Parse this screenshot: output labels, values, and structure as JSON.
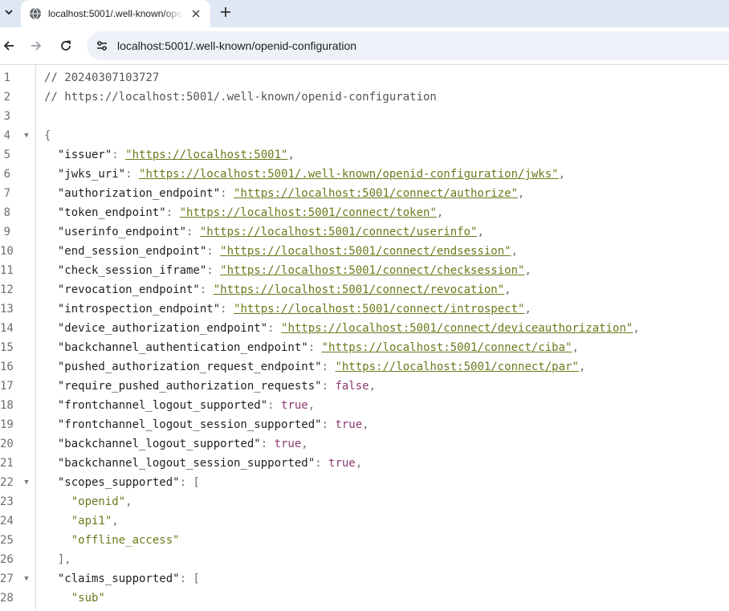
{
  "browser": {
    "tab": {
      "title": "localhost:5001/.well-known/openid-configuration",
      "globe_icon": "globe-icon",
      "close_icon": "close-icon"
    },
    "new_tab_icon": "plus-icon",
    "toolbar": {
      "back_icon": "arrow-left-icon",
      "forward_icon": "arrow-right-icon",
      "reload_icon": "reload-icon",
      "site_info_icon": "tune-icon",
      "url": "localhost:5001/.well-known/openid-configuration"
    }
  },
  "code": {
    "lines": [
      {
        "n": "1",
        "fold": "",
        "parts": [
          {
            "t": "// 20240307103727",
            "c": "comment"
          }
        ]
      },
      {
        "n": "2",
        "fold": "",
        "parts": [
          {
            "t": "// https://localhost:5001/.well-known/openid-configuration",
            "c": "comment"
          }
        ]
      },
      {
        "n": "3",
        "fold": "",
        "parts": []
      },
      {
        "n": "4",
        "fold": "▼",
        "parts": [
          {
            "t": "{",
            "c": "punct"
          }
        ]
      },
      {
        "n": "5",
        "fold": "",
        "parts": [
          {
            "t": "  \"issuer\"",
            "c": "key"
          },
          {
            "t": ": ",
            "c": "punct"
          },
          {
            "t": "\"https://localhost:5001\"",
            "c": "link"
          },
          {
            "t": ",",
            "c": "punct"
          }
        ]
      },
      {
        "n": "6",
        "fold": "",
        "parts": [
          {
            "t": "  \"jwks_uri\"",
            "c": "key"
          },
          {
            "t": ": ",
            "c": "punct"
          },
          {
            "t": "\"https://localhost:5001/.well-known/openid-configuration/jwks\"",
            "c": "link"
          },
          {
            "t": ",",
            "c": "punct"
          }
        ]
      },
      {
        "n": "7",
        "fold": "",
        "parts": [
          {
            "t": "  \"authorization_endpoint\"",
            "c": "key"
          },
          {
            "t": ": ",
            "c": "punct"
          },
          {
            "t": "\"https://localhost:5001/connect/authorize\"",
            "c": "link"
          },
          {
            "t": ",",
            "c": "punct"
          }
        ]
      },
      {
        "n": "8",
        "fold": "",
        "parts": [
          {
            "t": "  \"token_endpoint\"",
            "c": "key"
          },
          {
            "t": ": ",
            "c": "punct"
          },
          {
            "t": "\"https://localhost:5001/connect/token\"",
            "c": "link"
          },
          {
            "t": ",",
            "c": "punct"
          }
        ]
      },
      {
        "n": "9",
        "fold": "",
        "parts": [
          {
            "t": "  \"userinfo_endpoint\"",
            "c": "key"
          },
          {
            "t": ": ",
            "c": "punct"
          },
          {
            "t": "\"https://localhost:5001/connect/userinfo\"",
            "c": "link"
          },
          {
            "t": ",",
            "c": "punct"
          }
        ]
      },
      {
        "n": "10",
        "fold": "",
        "parts": [
          {
            "t": "  \"end_session_endpoint\"",
            "c": "key"
          },
          {
            "t": ": ",
            "c": "punct"
          },
          {
            "t": "\"https://localhost:5001/connect/endsession\"",
            "c": "link"
          },
          {
            "t": ",",
            "c": "punct"
          }
        ]
      },
      {
        "n": "11",
        "fold": "",
        "parts": [
          {
            "t": "  \"check_session_iframe\"",
            "c": "key"
          },
          {
            "t": ": ",
            "c": "punct"
          },
          {
            "t": "\"https://localhost:5001/connect/checksession\"",
            "c": "link"
          },
          {
            "t": ",",
            "c": "punct"
          }
        ]
      },
      {
        "n": "12",
        "fold": "",
        "parts": [
          {
            "t": "  \"revocation_endpoint\"",
            "c": "key"
          },
          {
            "t": ": ",
            "c": "punct"
          },
          {
            "t": "\"https://localhost:5001/connect/revocation\"",
            "c": "link"
          },
          {
            "t": ",",
            "c": "punct"
          }
        ]
      },
      {
        "n": "13",
        "fold": "",
        "parts": [
          {
            "t": "  \"introspection_endpoint\"",
            "c": "key"
          },
          {
            "t": ": ",
            "c": "punct"
          },
          {
            "t": "\"https://localhost:5001/connect/introspect\"",
            "c": "link"
          },
          {
            "t": ",",
            "c": "punct"
          }
        ]
      },
      {
        "n": "14",
        "fold": "",
        "parts": [
          {
            "t": "  \"device_authorization_endpoint\"",
            "c": "key"
          },
          {
            "t": ": ",
            "c": "punct"
          },
          {
            "t": "\"https://localhost:5001/connect/deviceauthorization\"",
            "c": "link"
          },
          {
            "t": ",",
            "c": "punct"
          }
        ]
      },
      {
        "n": "15",
        "fold": "",
        "parts": [
          {
            "t": "  \"backchannel_authentication_endpoint\"",
            "c": "key"
          },
          {
            "t": ": ",
            "c": "punct"
          },
          {
            "t": "\"https://localhost:5001/connect/ciba\"",
            "c": "link"
          },
          {
            "t": ",",
            "c": "punct"
          }
        ]
      },
      {
        "n": "16",
        "fold": "",
        "parts": [
          {
            "t": "  \"pushed_authorization_request_endpoint\"",
            "c": "key"
          },
          {
            "t": ": ",
            "c": "punct"
          },
          {
            "t": "\"https://localhost:5001/connect/par\"",
            "c": "link"
          },
          {
            "t": ",",
            "c": "punct"
          }
        ]
      },
      {
        "n": "17",
        "fold": "",
        "parts": [
          {
            "t": "  \"require_pushed_authorization_requests\"",
            "c": "key"
          },
          {
            "t": ": ",
            "c": "punct"
          },
          {
            "t": "false",
            "c": "bool"
          },
          {
            "t": ",",
            "c": "punct"
          }
        ]
      },
      {
        "n": "18",
        "fold": "",
        "parts": [
          {
            "t": "  \"frontchannel_logout_supported\"",
            "c": "key"
          },
          {
            "t": ": ",
            "c": "punct"
          },
          {
            "t": "true",
            "c": "bool"
          },
          {
            "t": ",",
            "c": "punct"
          }
        ]
      },
      {
        "n": "19",
        "fold": "",
        "parts": [
          {
            "t": "  \"frontchannel_logout_session_supported\"",
            "c": "key"
          },
          {
            "t": ": ",
            "c": "punct"
          },
          {
            "t": "true",
            "c": "bool"
          },
          {
            "t": ",",
            "c": "punct"
          }
        ]
      },
      {
        "n": "20",
        "fold": "",
        "parts": [
          {
            "t": "  \"backchannel_logout_supported\"",
            "c": "key"
          },
          {
            "t": ": ",
            "c": "punct"
          },
          {
            "t": "true",
            "c": "bool"
          },
          {
            "t": ",",
            "c": "punct"
          }
        ]
      },
      {
        "n": "21",
        "fold": "",
        "parts": [
          {
            "t": "  \"backchannel_logout_session_supported\"",
            "c": "key"
          },
          {
            "t": ": ",
            "c": "punct"
          },
          {
            "t": "true",
            "c": "bool"
          },
          {
            "t": ",",
            "c": "punct"
          }
        ]
      },
      {
        "n": "22",
        "fold": "▼",
        "parts": [
          {
            "t": "  \"scopes_supported\"",
            "c": "key"
          },
          {
            "t": ": [",
            "c": "punct"
          }
        ]
      },
      {
        "n": "23",
        "fold": "",
        "parts": [
          {
            "t": "    \"openid\"",
            "c": "str"
          },
          {
            "t": ",",
            "c": "punct"
          }
        ]
      },
      {
        "n": "24",
        "fold": "",
        "parts": [
          {
            "t": "    \"api1\"",
            "c": "str"
          },
          {
            "t": ",",
            "c": "punct"
          }
        ]
      },
      {
        "n": "25",
        "fold": "",
        "parts": [
          {
            "t": "    \"offline_access\"",
            "c": "str"
          }
        ]
      },
      {
        "n": "26",
        "fold": "",
        "parts": [
          {
            "t": "  ],",
            "c": "punct"
          }
        ]
      },
      {
        "n": "27",
        "fold": "▼",
        "parts": [
          {
            "t": "  \"claims_supported\"",
            "c": "key"
          },
          {
            "t": ": [",
            "c": "punct"
          }
        ]
      },
      {
        "n": "28",
        "fold": "",
        "parts": [
          {
            "t": "    \"sub\"",
            "c": "str"
          }
        ]
      }
    ]
  }
}
